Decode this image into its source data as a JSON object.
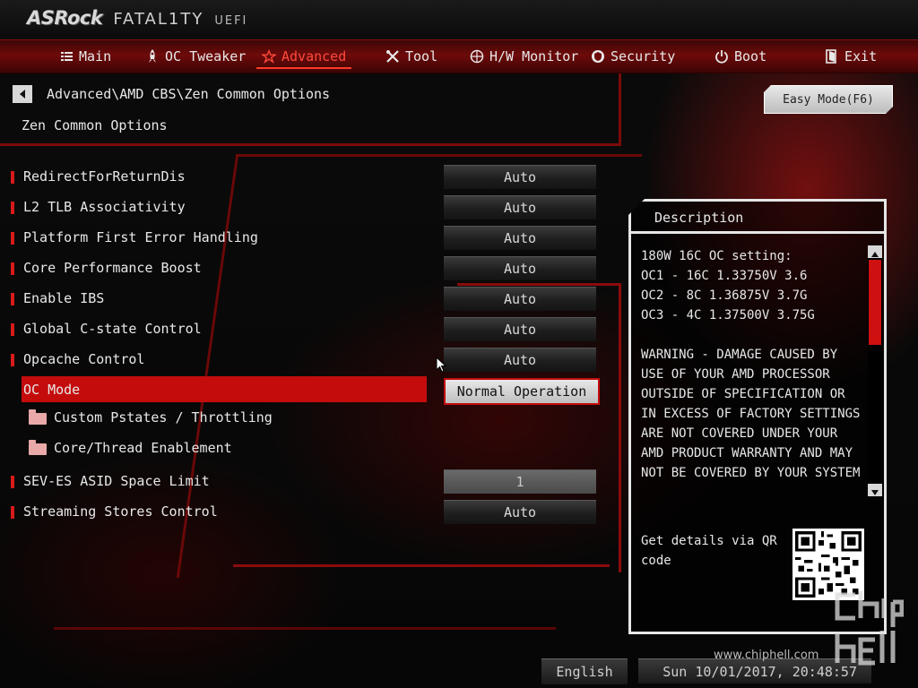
{
  "brand": {
    "name": "ASRock",
    "line": "FATAL1TY",
    "suffix": "UEFI"
  },
  "nav": {
    "items": [
      {
        "label": "Main",
        "icon": "list-icon"
      },
      {
        "label": "OC Tweaker",
        "icon": "rocket-icon"
      },
      {
        "label": "Advanced",
        "icon": "star-icon",
        "active": true
      },
      {
        "label": "Tool",
        "icon": "tools-icon"
      },
      {
        "label": "H/W Monitor",
        "icon": "monitor-icon"
      },
      {
        "label": "Security",
        "icon": "shield-icon"
      },
      {
        "label": "Boot",
        "icon": "power-icon"
      },
      {
        "label": "Exit",
        "icon": "exit-icon"
      }
    ]
  },
  "breadcrumb": "Advanced\\AMD CBS\\Zen Common Options",
  "page_title": "Zen Common Options",
  "easy_mode_label": "Easy Mode(F6)",
  "settings": [
    {
      "label": "RedirectForReturnDis",
      "value": "Auto"
    },
    {
      "label": "L2 TLB Associativity",
      "value": "Auto"
    },
    {
      "label": "Platform First Error Handling",
      "value": "Auto"
    },
    {
      "label": "Core Performance Boost",
      "value": "Auto"
    },
    {
      "label": "Enable IBS",
      "value": "Auto"
    },
    {
      "label": "Global C-state Control",
      "value": "Auto"
    },
    {
      "label": "Opcache Control",
      "value": "Auto"
    },
    {
      "label": "OC Mode",
      "value": "Normal Operation"
    },
    {
      "label": "Custom Pstates / Throttling"
    },
    {
      "label": "Core/Thread Enablement"
    },
    {
      "label": "SEV-ES ASID Space Limit",
      "value": "1"
    },
    {
      "label": "Streaming Stores Control",
      "value": "Auto"
    }
  ],
  "description": {
    "title": "Description",
    "text": "180W 16C OC setting:\nOC1 - 16C 1.33750V 3.6\nOC2 -  8C 1.36875V 3.7G\nOC3 -  4C 1.37500V 3.75G\n\nWARNING - DAMAGE CAUSED BY USE OF YOUR AMD PROCESSOR OUTSIDE OF SPECIFICATION OR IN EXCESS OF FACTORY SETTINGS ARE NOT COVERED UNDER YOUR AMD PRODUCT WARRANTY AND MAY NOT BE COVERED BY YOUR SYSTEM",
    "qr_label": "Get details via QR code"
  },
  "footer": {
    "language": "English",
    "datetime": "Sun 10/01/2017, 20:48:57"
  },
  "watermark": {
    "url": "www.chiphell.com"
  },
  "colors": {
    "accent": "#c40c0c",
    "nav_bg": "#6e0a0a",
    "active_tab": "#ff4a3a"
  }
}
